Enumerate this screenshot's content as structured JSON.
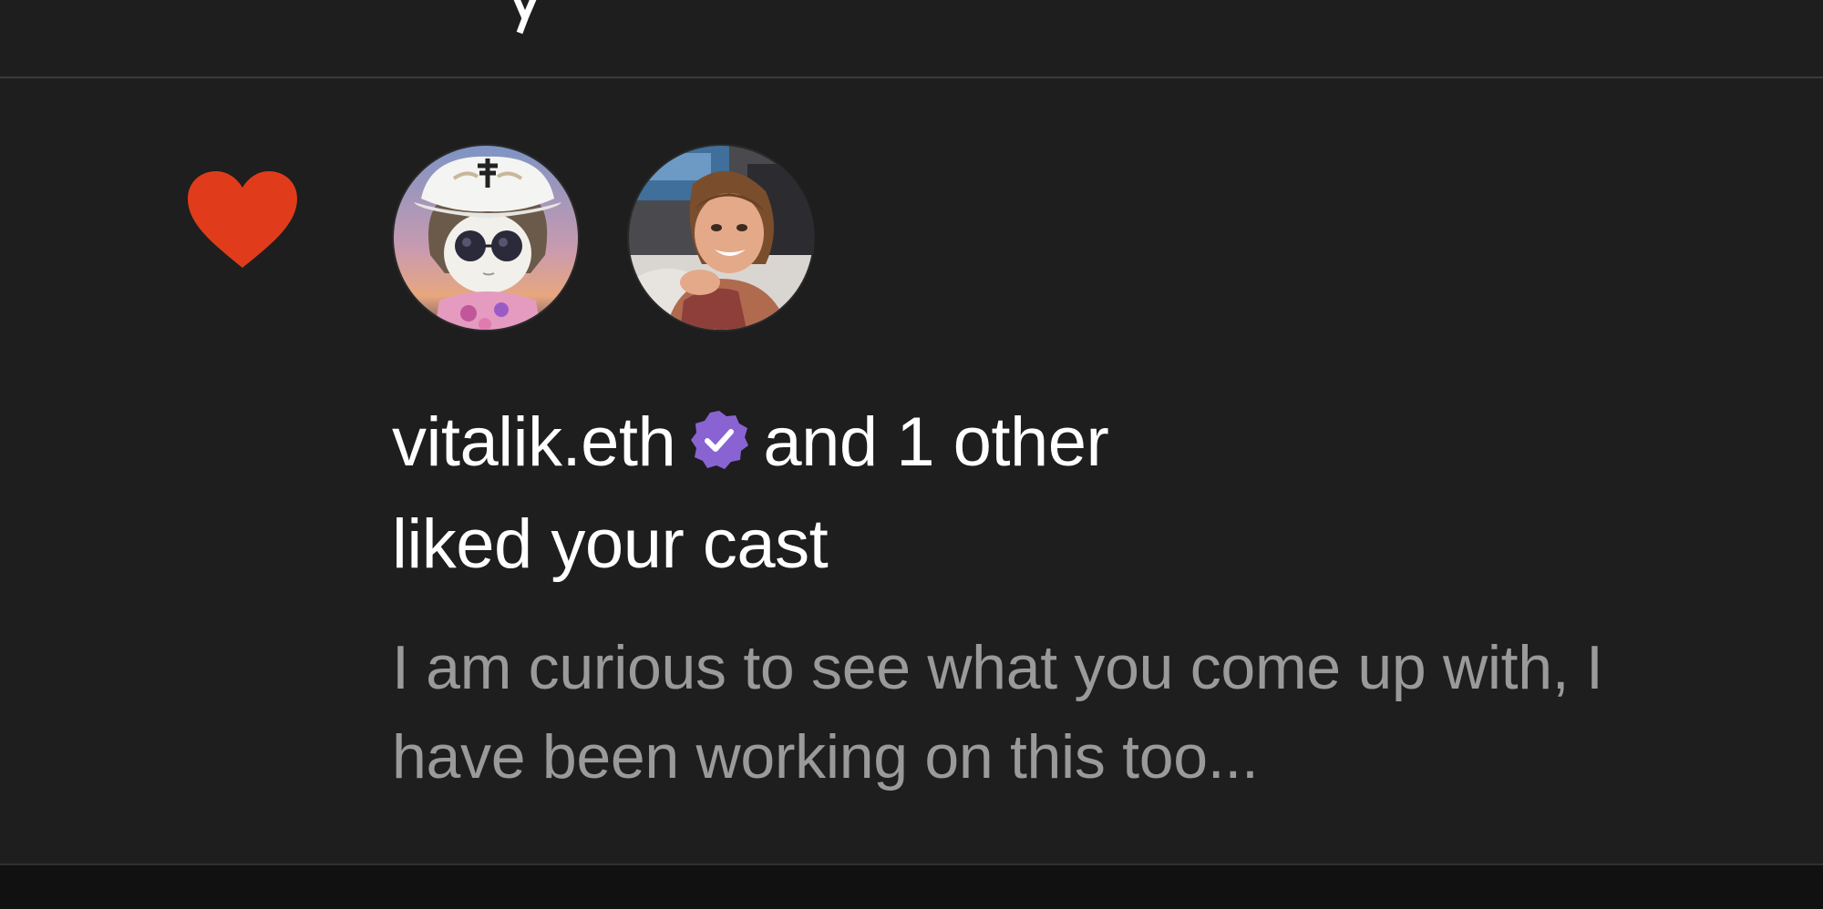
{
  "notification": {
    "type_icon": "heart-icon",
    "avatars": [
      {
        "icon": "avatar-cartoon-bucket-hat"
      },
      {
        "icon": "avatar-photo-smiling-woman"
      }
    ],
    "actor_name": "vitalik.eth",
    "verified_icon": "verified-badge-icon",
    "others_text": "and 1 other",
    "action_text": "liked your cast",
    "cast_preview": "I am curious to see what you come up with, I have been working on this too..."
  },
  "colors": {
    "background": "#1e1e1e",
    "heart": "#e03c1c",
    "verified": "#8a63d2",
    "primary_text": "#ffffff",
    "secondary_text": "#9a9a9a",
    "divider": "#3b3b3b"
  }
}
